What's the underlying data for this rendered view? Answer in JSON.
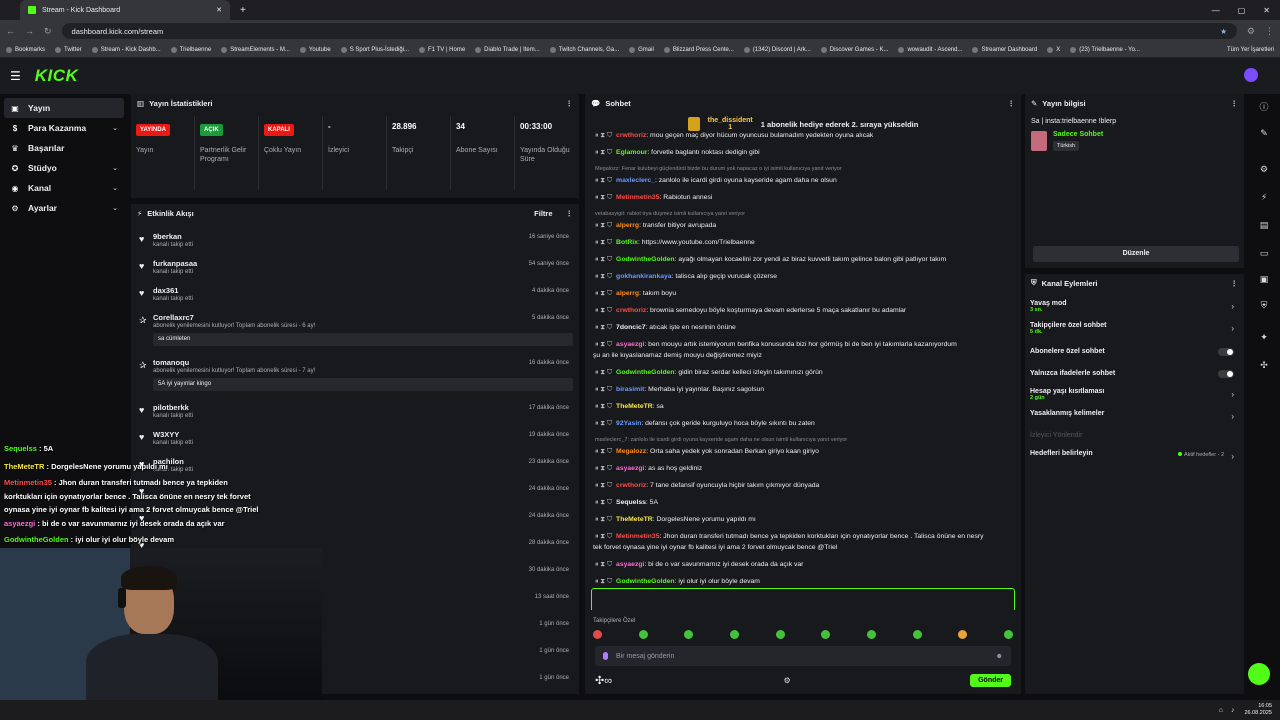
{
  "browser": {
    "tab_title": "Stream - Kick Dashboard",
    "url": "dashboard.kick.com/stream",
    "bookmarks": [
      "Bookmarks",
      "Twitter",
      "Stream - Kick Dashb...",
      "Trielbaenne",
      "StreamElements - M...",
      "Youtube",
      "S Sport Plus-İstediği...",
      "F1 TV | Home",
      "Diablo Trade | Item...",
      "Twitch Channels, Ga...",
      "Gmail",
      "Blizzard Press Cente...",
      "(1342) Discord | Ark...",
      "Discover Games - K...",
      "wowaudit - Ascend...",
      "Streamer Dashboard",
      "X",
      "(23) Trielbaenne - Yo..."
    ],
    "all_bookmarks": "Tüm Yer İşaretleri"
  },
  "header": {
    "logo": "KICK"
  },
  "nav": {
    "items": [
      {
        "label": "Yayın",
        "active": true,
        "has_chevron": false
      },
      {
        "label": "Para Kazanma",
        "has_chevron": true
      },
      {
        "label": "Başarılar",
        "has_chevron": false
      },
      {
        "label": "Stüdyo",
        "has_chevron": true
      },
      {
        "label": "Kanal",
        "has_chevron": true
      },
      {
        "label": "Ayarlar",
        "has_chevron": true
      }
    ]
  },
  "stats": {
    "title": "Yayın İstatistikleri",
    "cells": [
      {
        "badge": "YAYINDA",
        "badge_color": "red",
        "label": "Yayın"
      },
      {
        "badge": "AÇIK",
        "badge_color": "green",
        "label": "Partnerlik Gelir Programı"
      },
      {
        "badge": "KAPALI",
        "badge_color": "red",
        "label": "Çoklu Yayın"
      },
      {
        "value": "-",
        "label": "İzleyici"
      },
      {
        "value": "28.896",
        "label": "Takipçi"
      },
      {
        "value": "34",
        "label": "Abone Sayısı"
      },
      {
        "value": "00:33:00",
        "label": "Yayında Olduğu Süre"
      }
    ]
  },
  "activity": {
    "title": "Etkinlik Akışı",
    "filter": "Filtre",
    "items": [
      {
        "name": "9berkan",
        "sub": "kanalı takip etti",
        "time": "16 saniye önce",
        "icon": "heart"
      },
      {
        "name": "furkanpasaa",
        "sub": "kanalı takip etti",
        "time": "54 saniye önce",
        "icon": "heart"
      },
      {
        "name": "dax361",
        "sub": "kanalı takip etti",
        "time": "4 dakika önce",
        "icon": "heart"
      },
      {
        "name": "Corellaxrc7",
        "sub": "abonelik yenilemesini kutluyor! Toplam abonelik süresi - 6 ay!",
        "time": "5 dakika önce",
        "icon": "star",
        "msg": "sa cümleten"
      },
      {
        "name": "tomanoqu",
        "sub": "abonelik yenilemesini kutluyor! Toplam abonelik süresi - 7 ay!",
        "time": "16 dakika önce",
        "icon": "star",
        "msg": "5A iyi yayınlar kingo"
      },
      {
        "name": "pilotberkk",
        "sub": "kanalı takip etti",
        "time": "17 dakika önce",
        "icon": "heart"
      },
      {
        "name": "W3XYY",
        "sub": "kanalı takip etti",
        "time": "19 dakika önce",
        "icon": "heart"
      },
      {
        "name": "pachilon",
        "sub": "kanalı takip etti",
        "time": "23 dakika önce",
        "icon": "heart"
      },
      {
        "name": "",
        "sub": "",
        "time": "24 dakika önce",
        "icon": "heart"
      },
      {
        "name": "",
        "sub": "",
        "time": "24 dakika önce",
        "icon": "heart"
      },
      {
        "name": "",
        "sub": "",
        "time": "28 dakika önce",
        "icon": "heart"
      },
      {
        "name": "",
        "sub": "",
        "time": "30 dakika önce",
        "icon": "heart"
      },
      {
        "name": "",
        "sub": "",
        "time": "13 saat önce",
        "icon": "heart"
      },
      {
        "name": "",
        "sub": "",
        "time": "1 gün önce",
        "icon": "heart"
      },
      {
        "name": "",
        "sub": "",
        "time": "1 gün önce",
        "icon": "heart"
      },
      {
        "name": "",
        "sub": "",
        "time": "1 gün önce",
        "icon": "heart"
      }
    ]
  },
  "chat": {
    "title": "Sohbet",
    "pinned_user": "the_dissident",
    "pinned_count": "1",
    "pinned_text": "1 abonelik hediye ederek 2. sıraya yükseldin",
    "lines": [
      {
        "user": "crwthoriz",
        "color": "#ff4b4b",
        "text": ": mou geçen maç diyor hücum oyuncusu bulamadım yedekten oyuna alıcak"
      },
      {
        "user": "Eglamour",
        "color": "#53fc18",
        "text": ": forvetle baglantı noktası dedigin gibi"
      },
      {
        "reply": "Megalozz: Fenar kulubeyi güçlendirdi bizde bu durum yok napacaz o iyi isimli kullanıcıya yanıt veriyor"
      },
      {
        "user": "maxleclerc_",
        "color": "#6b9bff",
        "text": ": zanlolo ile icardi girdi oyuna kayseride agam daha ne olsun"
      },
      {
        "user": "Metinmetin35",
        "color": "#ff4b4b",
        "text": ": Rabiotun annesi"
      },
      {
        "reply": "vetabasyigit: rabiot trya düşmez isimli kullanıcıya yanıt veriyor"
      },
      {
        "user": "alperrg",
        "color": "#ff8c1a",
        "text": ": transfer bitiyor avrupada"
      },
      {
        "user": "BotRix",
        "color": "#53fc18",
        "text": ": https://www.youtube.com/Trielbaenne"
      },
      {
        "user": "GodwintheGolden",
        "color": "#53fc18",
        "text": ": ayağı olmayan kocaelini zor yendi az biraz kuvvetli takım gelince balon gibi patlıyor takım"
      },
      {
        "user": "gokhankirankaya",
        "color": "#6b9bff",
        "text": ": talisca alıp geçip vurucak çözerse"
      },
      {
        "user": "alperrg",
        "color": "#ff8c1a",
        "text": ": takım boyu"
      },
      {
        "user": "crwthoriz",
        "color": "#ff4b4b",
        "text": ": brownia semedoyu böyle koşturmaya devam ederlerse 5 maça sakatlanır bu adamlar"
      },
      {
        "user": "7doncic7",
        "color": "#efeff1",
        "text": ": atıcak işte en nesrinin önüne"
      },
      {
        "user": "asyaezgi",
        "color": "#ff6bd6",
        "text": ": ben mouyu artık istemiyorum benfika konusunda bizi hor görmüş bi de ben iyi takımlarla kazanıyordum"
      },
      {
        "cont": "şu an ile kıyaslanamaz demiş mouyu değiştiremez miyiz"
      },
      {
        "user": "GodwintheGolden",
        "color": "#53fc18",
        "text": ": gidin biraz serdar kelleci izleyin takımınızı görün"
      },
      {
        "user": "birasimit",
        "color": "#6b9bff",
        "text": ": Merhaba iyi yayınlar. Başınız sagolsun"
      },
      {
        "user": "TheMeteTR",
        "color": "#f7e948",
        "text": ": sa"
      },
      {
        "user": "92Yasin",
        "color": "#6b9bff",
        "text": ": defansı çok geride kurguluyo hoca böyle sıkıntı bu zaten"
      },
      {
        "reply": "maxleclerc_7: zanlolo ile icardi girdi oyuna kayseride agam daha ne olsun isimli kullanıcıya yanıt veriyor"
      },
      {
        "user": "Megalozz",
        "color": "#ff8c1a",
        "text": ": Orta saha yedek yok sonradan Berkan giriyo kaan giriyo"
      },
      {
        "user": "asyaezgi",
        "color": "#ff6bd6",
        "text": ": as as hoş geldiniz"
      },
      {
        "user": "crwthoriz",
        "color": "#ff4b4b",
        "text": ": 7 tane defansif oyuncuyla hiçbir takım çıkmıyor dünyada"
      },
      {
        "user": "Sequelss",
        "color": "#efeff1",
        "text": ": 5A"
      },
      {
        "user": "TheMeteTR",
        "color": "#f7e948",
        "text": ": DorgelesNene yorumu yapıldı mı"
      },
      {
        "user": "Metinmetin35",
        "color": "#ff4b4b",
        "text": ": Jhon duran transferi tutmadı bence ya tepkiden korktukları için oynatıyorlar bence . Talisca önüne en nesry"
      },
      {
        "cont": "tek forvet oynasa yine iyi oynar fb kalitesi iyi ama 2 forvet olmuycak bence @Triel"
      },
      {
        "user": "asyaezgi",
        "color": "#ff6bd6",
        "text": ": bi de o var savunmarnız iyi desek orada da açık var"
      },
      {
        "user": "GodwintheGolden",
        "color": "#53fc18",
        "text": ": iyi olur iyi olur böyle devam"
      }
    ],
    "followers_only": "Takipçilere Özel",
    "input_placeholder": "Bir mesaj gönderin",
    "send": "Gönder"
  },
  "info": {
    "title": "Yayın bilgisi",
    "stream_title": "Sa | insta:trielbaenne !blerp",
    "category": "Sadece Sohbet",
    "language": "Türkish",
    "edit": "Düzenle"
  },
  "channel_actions": {
    "title": "Kanal Eylemleri",
    "rows": [
      {
        "label": "Yavaş mod",
        "sub": "3 sn.",
        "type": "arrow"
      },
      {
        "label": "Takipçilere özel sohbet",
        "sub": "5 dk.",
        "type": "arrow"
      },
      {
        "label": "Abonelere özel sohbet",
        "type": "toggle"
      },
      {
        "label": "Yalnızca ifadelerle sohbet",
        "type": "toggle"
      },
      {
        "label": "Hesap yaşı kısıtlaması",
        "sub": "2 gün",
        "type": "arrow"
      },
      {
        "label": "Yasaklanmış kelimeler",
        "type": "arrow"
      },
      {
        "label": "İzleyici Yönlendir",
        "type": "muted"
      },
      {
        "label": "Hedefleri belirleyin",
        "goal": "Aktif hedefler - 2",
        "type": "arrow"
      }
    ]
  },
  "overlay": {
    "lines": [
      {
        "user": "Sequelss",
        "cls": "",
        "text": " : 5A"
      },
      {
        "user": "TheMeteTR",
        "cls": "yellow",
        "text": " : DorgelesNene yorumu yapıldı mı"
      },
      {
        "user": "Metinmetin35",
        "cls": "red",
        "text": " : Jhon duran transferi tutmadı bence ya tepkiden"
      },
      {
        "user": "",
        "cls": "",
        "text": "korktukları için oynatıyorlar bence . Talisca önüne en nesry tek forvet"
      },
      {
        "user": "",
        "cls": "",
        "text": "oynasa yine iyi oynar fb kalitesi iyi ama 2 forvet olmuycak bence @Triel"
      },
      {
        "user": "asyaezgi",
        "cls": "pink",
        "text": " : bi de o var savunmarnız iyi desek orada da açık var"
      },
      {
        "user": "GodwintheGolden",
        "cls": "",
        "text": " : iyi olur iyi olur böyle devam"
      }
    ]
  },
  "taskbar": {
    "time": "16:05",
    "date": "26.08.2025"
  }
}
